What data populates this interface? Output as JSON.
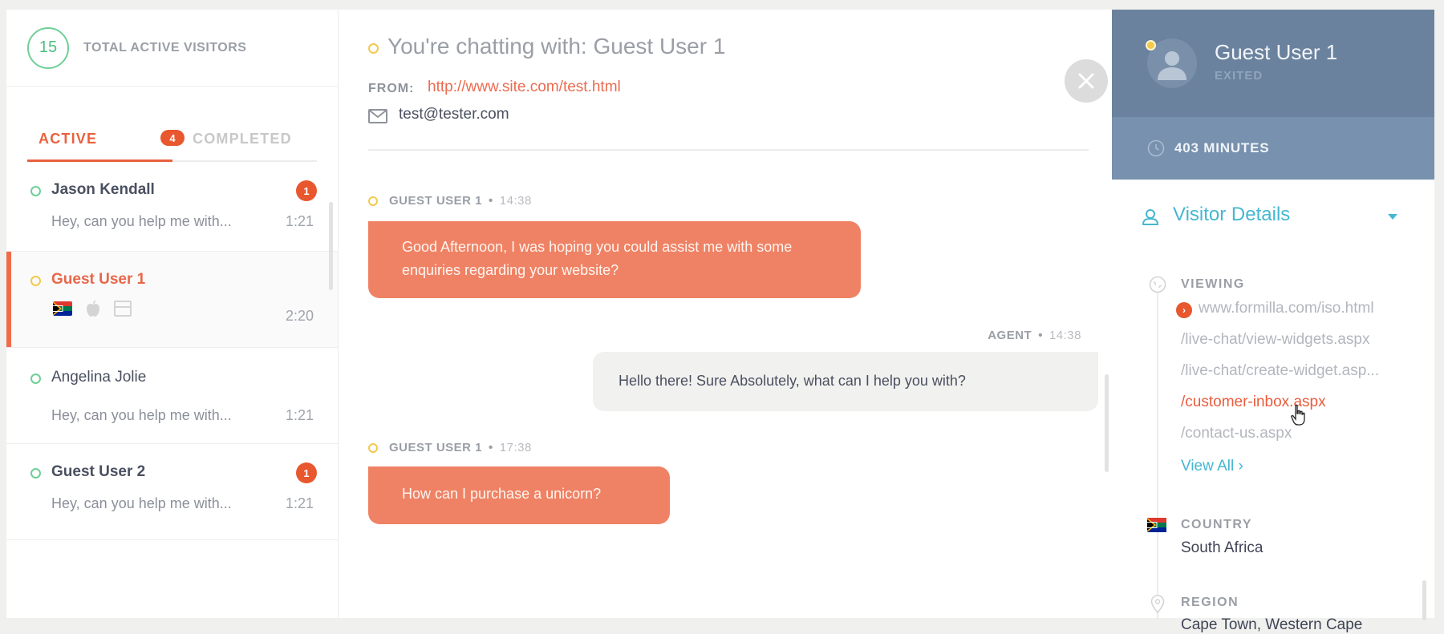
{
  "visitors": {
    "count": "15",
    "label": "TOTAL ACTIVE VISITORS"
  },
  "tabs": {
    "active": {
      "label": "ACTIVE",
      "badge": "4"
    },
    "completed": {
      "label": "COMPLETED"
    }
  },
  "chats": [
    {
      "name": "Jason Kendall",
      "status": "online",
      "preview": "Hey, can you help me with...",
      "time": "1:21",
      "unread": "1",
      "selected": false
    },
    {
      "name": "Guest User 1",
      "status": "away",
      "preview": "",
      "time": "2:20",
      "unread": null,
      "selected": true,
      "icons": [
        "south-africa-flag-icon",
        "apple-icon",
        "browser-window-icon"
      ]
    },
    {
      "name": "Angelina Jolie",
      "status": "online",
      "preview": "Hey, can you help me with...",
      "time": "1:21",
      "unread": null,
      "selected": false
    },
    {
      "name": "Guest User 2",
      "status": "online",
      "preview": "Hey, can you help me with...",
      "time": "1:21",
      "unread": "1",
      "selected": false
    }
  ],
  "conversation": {
    "title": "You're chatting with: Guest User 1",
    "from_label": "FROM:",
    "from_url": "http://www.site.com/test.html",
    "email": "test@tester.com",
    "close_icon": "close-icon",
    "messages": [
      {
        "sender": "GUEST USER 1",
        "role": "guest",
        "time": "14:38",
        "text": "Good Afternoon, I was hoping you could assist me with some enquiries regarding your website?"
      },
      {
        "sender": "AGENT",
        "role": "agent",
        "time": "14:38",
        "text": "Hello there! Sure Absolutely, what can I help you with?"
      },
      {
        "sender": "GUEST USER 1",
        "role": "guest",
        "time": "17:38",
        "text": "How can I purchase a unicorn?"
      }
    ],
    "separator": "•"
  },
  "profile": {
    "name": "Guest User 1",
    "status": "EXITED",
    "duration": "403 MINUTES"
  },
  "visitor_details": {
    "title": "Visitor Details",
    "viewing": {
      "label": "VIEWING",
      "current_badge": "›",
      "pages": [
        {
          "url": "www.formilla.com/iso.html",
          "current": true,
          "hover": false
        },
        {
          "url": "/live-chat/view-widgets.aspx",
          "current": false,
          "hover": false
        },
        {
          "url": "/live-chat/create-widget.asp...",
          "current": false,
          "hover": false
        },
        {
          "url": "/customer-inbox.aspx",
          "current": false,
          "hover": true
        },
        {
          "url": "/contact-us.aspx",
          "current": false,
          "hover": false
        }
      ],
      "view_all": "View All ›"
    },
    "country": {
      "label": "COUNTRY",
      "value": "South Africa"
    },
    "region": {
      "label": "REGION",
      "value": "Cape Town, Western Cape"
    }
  },
  "colors": {
    "accent": "#e8613f",
    "badge": "#e8572d",
    "guest_bubble": "#ef8265",
    "agent_bubble": "#f1f1ef",
    "profile_bg": "#6b829e",
    "duration_bg": "#7791ae",
    "link_blue": "#45b7d1",
    "online": "#6fcf97",
    "away": "#f2c94c"
  }
}
